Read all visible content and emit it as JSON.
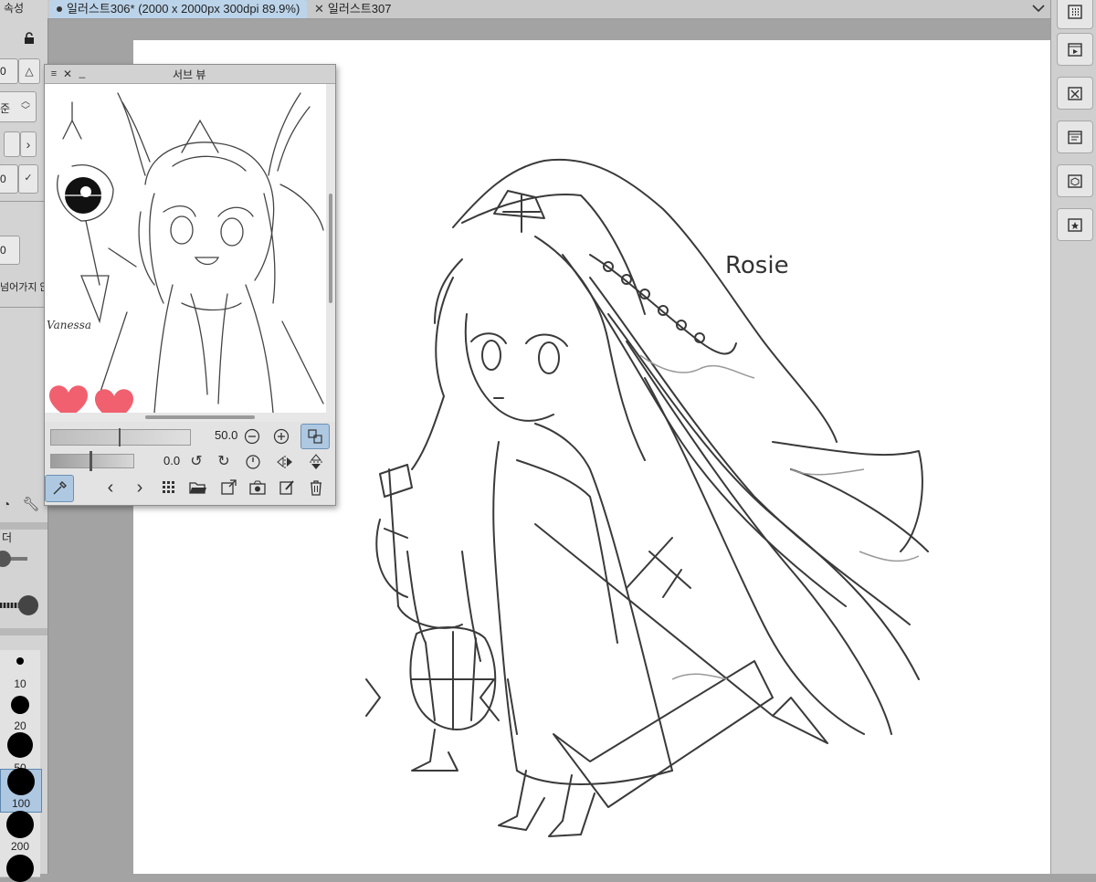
{
  "tabs": [
    {
      "label": "일러스트306* (2000 x 2000px 300dpi 89.9%)",
      "active": true
    },
    {
      "label": "일러스트307",
      "active": false
    }
  ],
  "left_panel": {
    "title": "속성",
    "value_0a": "0",
    "value_jun": "준",
    "value_0b": "0",
    "value_0c": "0",
    "cut_text": "넘어가지 않",
    "section2_title": "더"
  },
  "brush_sizes": [
    "10",
    "20",
    "50",
    "100",
    "200"
  ],
  "sub_view": {
    "title": "서브 뷰",
    "zoom_value": "50.0",
    "rotate_value": "0.0",
    "image_signature": "Vanessa"
  },
  "canvas": {
    "signature": "Rosie"
  },
  "colors": {
    "active_tab": "#bcd4ea",
    "highlight": "#aec8e2",
    "heart": "#f0606e"
  },
  "icons": {
    "tab_close": "close-icon",
    "tab_menu": "chevron-down-icon",
    "right_tools": [
      "grid-icon",
      "animation-icon",
      "timeline-icon",
      "layer-panel-icon",
      "material-icon",
      "star-icon"
    ]
  }
}
